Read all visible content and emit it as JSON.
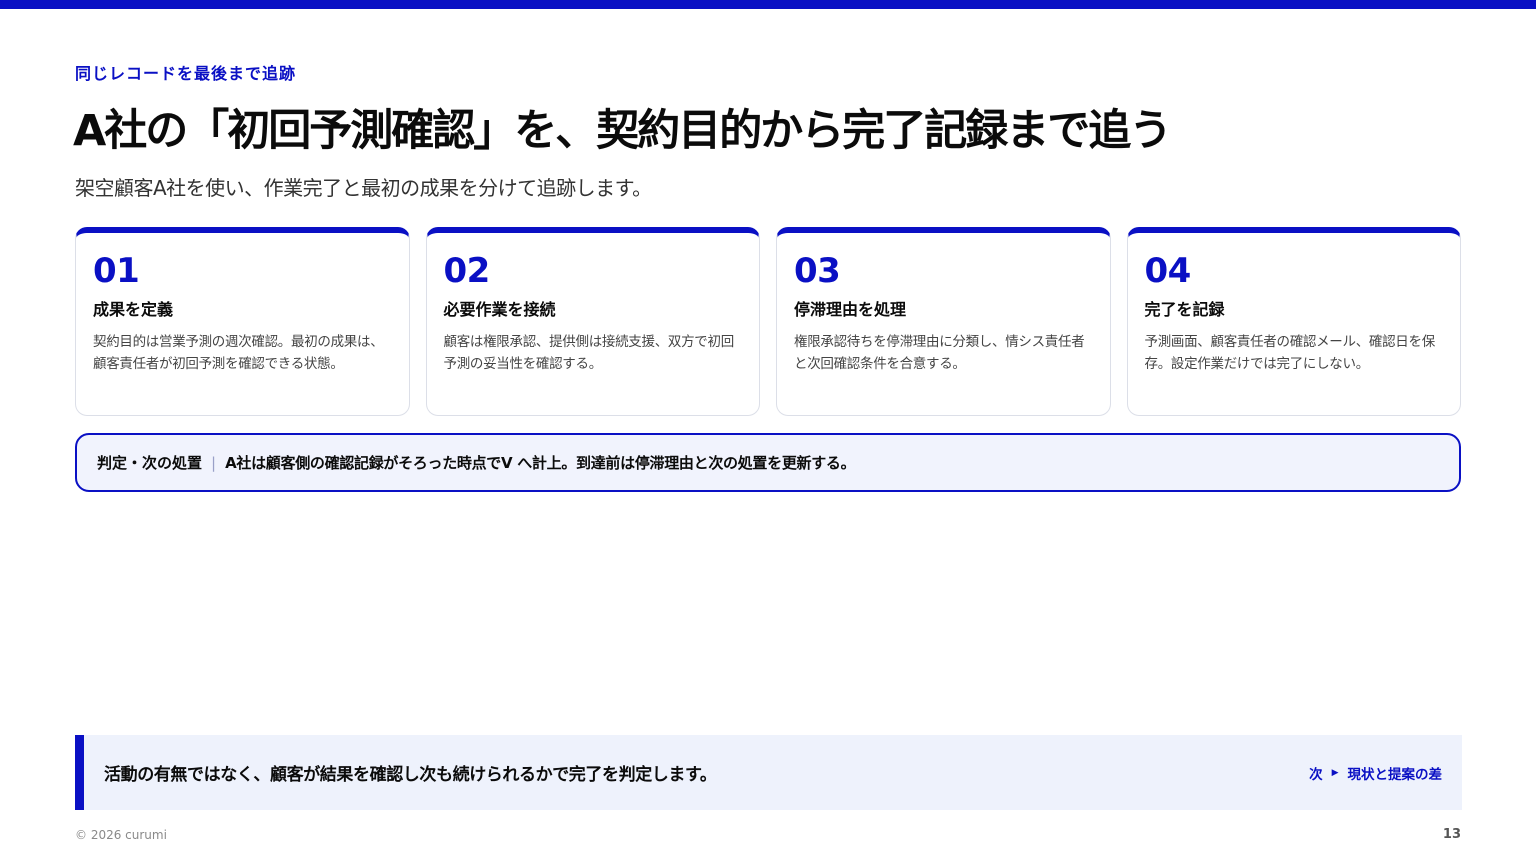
{
  "slide": {
    "eyebrow": "同じレコードを最後まで追跡",
    "title": "A社の「初回予測確認」を、契約目的から完了記録まで追う",
    "subtitle": "架空顧客A社を使い、作業完了と最初の成果を分けて追跡します。"
  },
  "steps": [
    {
      "num": "01",
      "heading": "成果を定義",
      "body": "契約目的は営業予測の週次確認。最初の成果は、顧客責任者が初回予測を確認できる状態。"
    },
    {
      "num": "02",
      "heading": "必要作業を接続",
      "body": "顧客は権限承認、提供側は接続支援、双方で初回予測の妥当性を確認する。"
    },
    {
      "num": "03",
      "heading": "停滞理由を処理",
      "body": "権限承認待ちを停滞理由に分類し、情シス責任者と次回確認条件を合意する。"
    },
    {
      "num": "04",
      "heading": "完了を記録",
      "body": "予測画面、顧客責任者の確認メール、確認日を保存。設定作業だけでは完了にしない。"
    }
  ],
  "verdict": {
    "label": "判定・次の処置",
    "separator": "|",
    "text": "A社は顧客側の確認記録がそろった時点でV へ計上。到達前は停滞理由と次の処置を更新する。"
  },
  "callout": {
    "text": "活動の有無ではなく、顧客が結果を確認し次も続けられるかで完了を判定します。",
    "next_prefix": "次",
    "next_arrow_icon": "play-arrow-icon",
    "next_label": "現状と提案の差"
  },
  "footer": {
    "copyright": "© 2026 curumi",
    "page_number": "13"
  },
  "colors": {
    "accent": "#0a10c4",
    "callout_bg": "#eef2fc",
    "verdict_bg": "#f1f3fd"
  }
}
